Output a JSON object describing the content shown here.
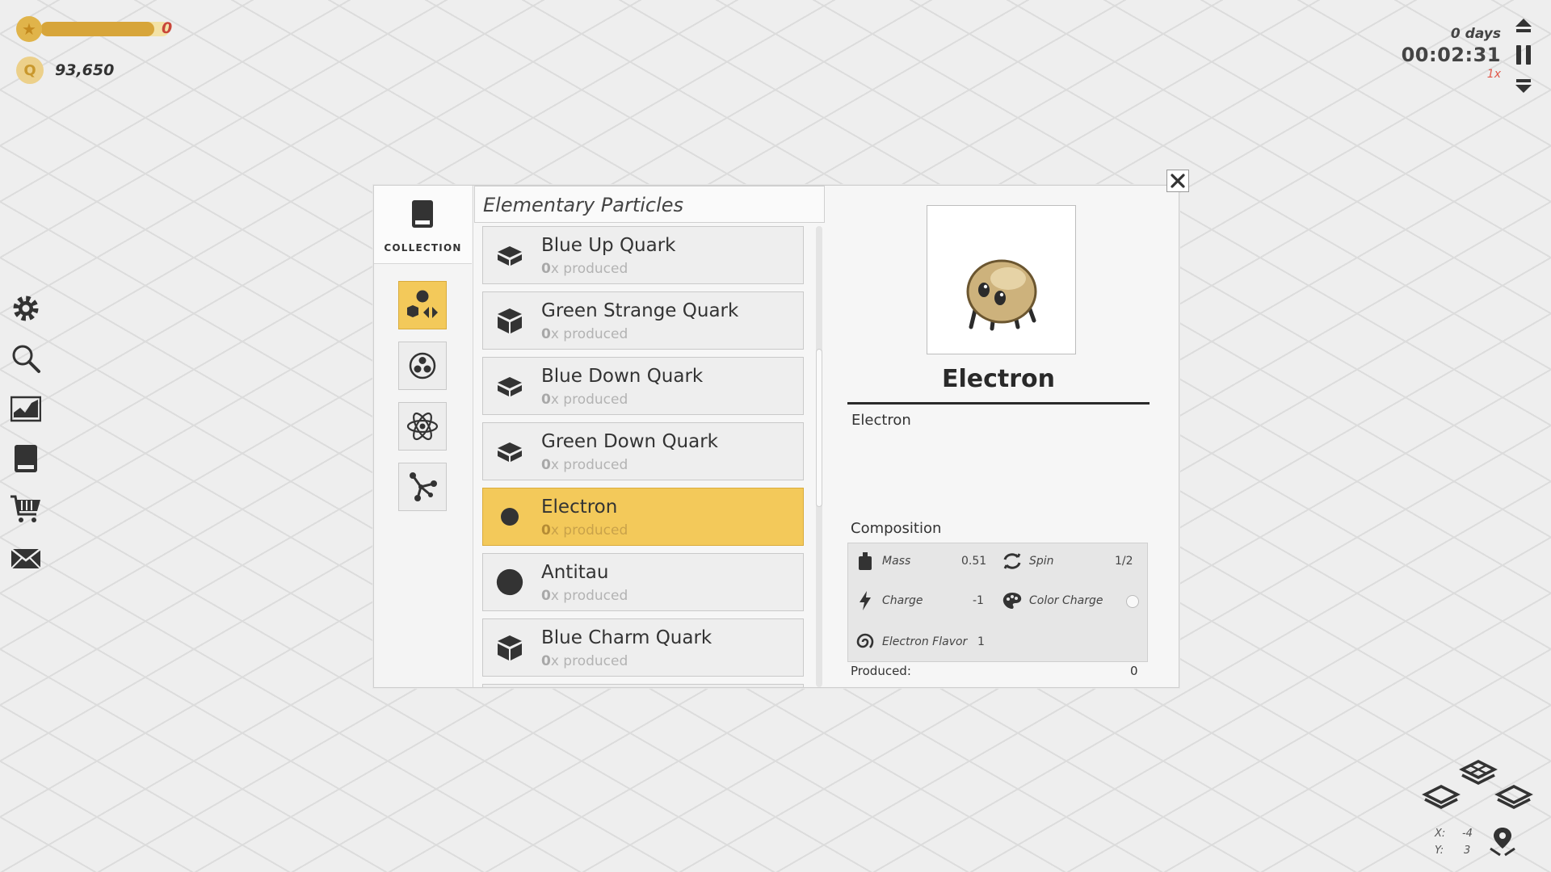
{
  "hud": {
    "level_value": "0",
    "xp_progress": 0.88,
    "coins": "93,650",
    "coin_glyph": "Q",
    "days": "0 days",
    "clock": "00:02:31",
    "speed": "1x"
  },
  "sidebar_tools": [
    "gear-icon",
    "search-icon",
    "chart-icon",
    "book-icon",
    "cart-icon",
    "mail-icon"
  ],
  "modal": {
    "tab_label": "COLLECTION",
    "list_title": "Elementary Particles",
    "items": [
      {
        "name": "Blue Up Quark",
        "count": "0",
        "suffix": "x produced",
        "icon": "cube-flat-icon"
      },
      {
        "name": "Green Strange Quark",
        "count": "0",
        "suffix": "x produced",
        "icon": "cube-icon"
      },
      {
        "name": "Blue Down Quark",
        "count": "0",
        "suffix": "x produced",
        "icon": "cube-flat-icon"
      },
      {
        "name": "Green Down Quark",
        "count": "0",
        "suffix": "x produced",
        "icon": "cube-flat-icon"
      },
      {
        "name": "Electron",
        "count": "0",
        "suffix": "x produced",
        "icon": "small-circle-icon"
      },
      {
        "name": "Antitau",
        "count": "0",
        "suffix": "x produced",
        "icon": "large-circle-icon"
      },
      {
        "name": "Blue Charm Quark",
        "count": "0",
        "suffix": "x produced",
        "icon": "cube-icon"
      }
    ],
    "detail": {
      "title": "Electron",
      "description": "Electron",
      "composition_label": "Composition",
      "mass_label": "Mass",
      "mass_value": "0.51",
      "spin_label": "Spin",
      "spin_value": "1/2",
      "charge_label": "Charge",
      "charge_value": "-1",
      "color_charge_label": "Color Charge",
      "flavor_label": "Electron Flavor",
      "flavor_value": "1",
      "produced_label": "Produced:",
      "produced_value": "0"
    }
  },
  "map": {
    "x_label": "X:",
    "x_value": "-4",
    "y_label": "Y:",
    "y_value": "3"
  },
  "colors": {
    "accent": "#f3c95a",
    "xp_fill": "#d7a53a",
    "level_text": "#c8463a",
    "speed_text": "#e0584a"
  }
}
